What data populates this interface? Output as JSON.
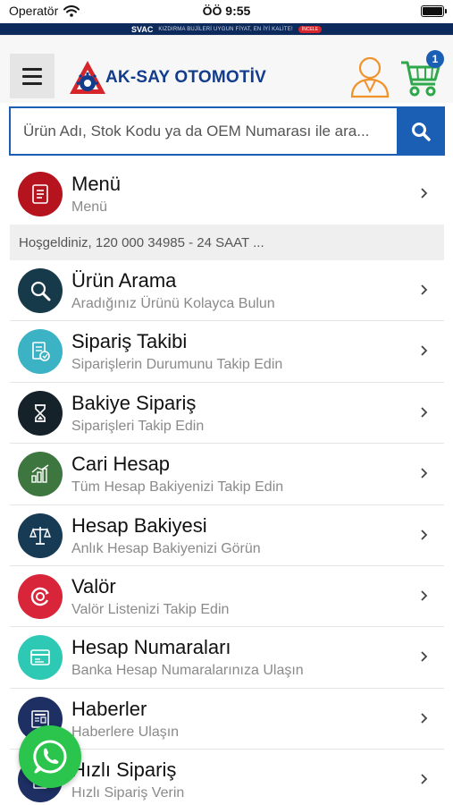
{
  "status_bar": {
    "carrier": "Operatör",
    "time": "ÖÖ 9:55"
  },
  "promo": {
    "brand": "SVAC",
    "text": "KIZDIRMA BUJİLERİ UYGUN FİYAT, EN İYİ KALİTE!",
    "cta": "İNCELE"
  },
  "header": {
    "logo_text": "AK-SAY OTOMOTİV",
    "cart_count": "1"
  },
  "search": {
    "placeholder": "Ürün Adı, Stok Kodu ya da OEM Numarası ile ara..."
  },
  "menu_item": {
    "title": "Menü",
    "subtitle": "Menü",
    "color": "#b5141f",
    "icon": "list-icon"
  },
  "welcome_text": "Hoşgeldiniz, 120 000 34985 - 24 SAAT ...",
  "items": [
    {
      "title": "Ürün Arama",
      "subtitle": "Aradığınız Ürünü Kolayca Bulun",
      "color": "#163a4a",
      "icon": "magnifier-icon"
    },
    {
      "title": "Sipariş Takibi",
      "subtitle": "Siparişlerin Durumunu Takip Edin",
      "color": "#3bb3c4",
      "icon": "order-document-icon"
    },
    {
      "title": "Bakiye Sipariş",
      "subtitle": "Siparişleri Takip Edin",
      "color": "#15222a",
      "icon": "hourglass-icon"
    },
    {
      "title": "Cari Hesap",
      "subtitle": "Tüm Hesap Bakiyenizi Takip Edin",
      "color": "#3e7640",
      "icon": "bar-chart-icon"
    },
    {
      "title": "Hesap Bakiyesi",
      "subtitle": "Anlık Hesap Bakiyenizi Görün",
      "color": "#173a55",
      "icon": "scales-icon"
    },
    {
      "title": "Valör",
      "subtitle": "Valör Listenizi Takip Edin",
      "color": "#d9253a",
      "icon": "cycle-icon"
    },
    {
      "title": "Hesap Numaraları",
      "subtitle": "Banka Hesap Numaralarınıza Ulaşın",
      "color": "#2ec9b4",
      "icon": "bank-card-icon"
    },
    {
      "title": "Haberler",
      "subtitle": "Haberlere Ulaşın",
      "color": "#1d2f63",
      "icon": "newspaper-icon"
    },
    {
      "title": "Hızlı Sipariş",
      "subtitle": "Hızlı Sipariş Verin",
      "color": "#1d2f63",
      "icon": "quick-order-icon"
    }
  ],
  "colors": {
    "accent": "#1a5fb4",
    "logo_red": "#d6262b",
    "whatsapp": "#2bc44d"
  }
}
